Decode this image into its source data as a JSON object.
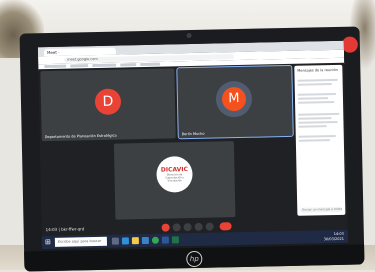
{
  "browser": {
    "tab_title": "Meet - ",
    "url": "meet.google.com"
  },
  "meeting": {
    "participants": [
      {
        "initial": "D",
        "name": "Departamento de Planeación Estratégica",
        "color": "#ea4335"
      },
      {
        "initial": "M",
        "name": "Berlín Mucho",
        "color": "#f4511e"
      }
    ],
    "logo": {
      "title": "DICAVIC",
      "subtitle": "Dirección de Capacitación y Vinculación"
    },
    "time_label": "14:03 | ",
    "meeting_code": "bkr-ffwr-qrd"
  },
  "chat": {
    "title": "Mensajes de la reunión",
    "input_placeholder": "Enviar un mensaje a todos"
  },
  "taskbar": {
    "search_placeholder": "Escribe aquí para buscar",
    "tray_time": "14:03",
    "tray_date": "30/03/2021"
  },
  "device": {
    "brand": "hp"
  },
  "colors": {
    "meet_background": "#202124",
    "tile": "#3c4043",
    "end_call": "#ea4335",
    "active_outline": "#8ab4f8"
  }
}
